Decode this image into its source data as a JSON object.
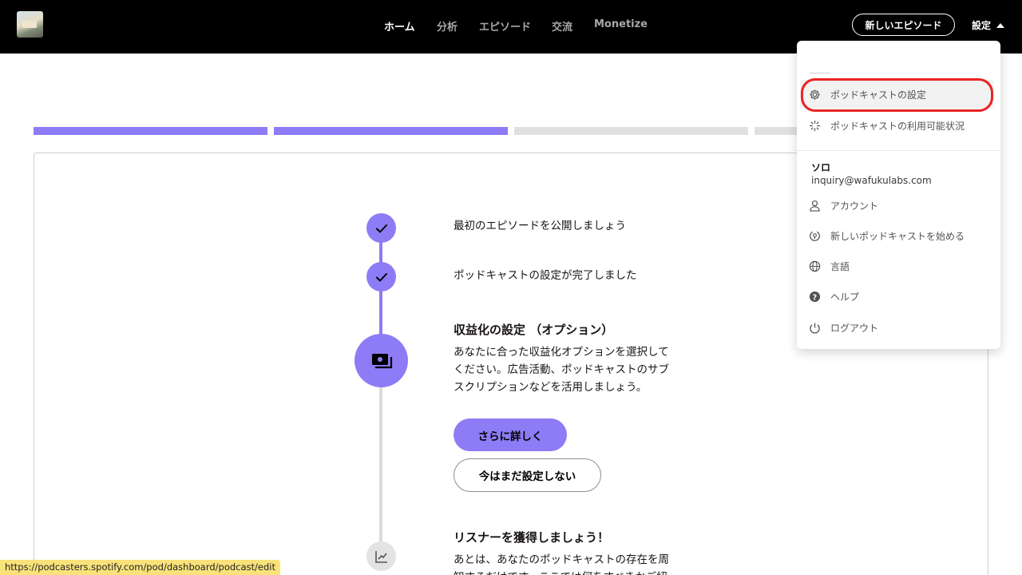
{
  "nav": {
    "items": [
      {
        "label": "ホーム",
        "active": true
      },
      {
        "label": "分析",
        "active": false
      },
      {
        "label": "エピソード",
        "active": false
      },
      {
        "label": "交流",
        "active": false
      },
      {
        "label": "Monetize",
        "active": false
      }
    ],
    "new_episode_label": "新しいエピソード",
    "settings_label": "設定"
  },
  "progress": {
    "completed_segments": 2,
    "total_segments": 4
  },
  "steps": {
    "step1": {
      "text": "最初のエピソードを公開しましょう",
      "status": "done"
    },
    "step2": {
      "text": "ポッドキャストの設定が完了しました",
      "status": "done"
    },
    "step3": {
      "title": "収益化の設定 （オプション）",
      "description": "あなたに合った収益化オプションを選択してください。広告活動、ポッドキャストのサブスクリプションなどを活用しましょう。",
      "primary_button": "さらに詳しく",
      "secondary_button": "今はまだ設定しない"
    },
    "step4": {
      "title": "リスナーを獲得しましょう！",
      "description": "あとは、あなたのポッドキャストの存在を周知するだけです。ここでは何をすべきかご紹介します。"
    }
  },
  "dropdown": {
    "items_top": [
      {
        "label": "ポッドキャストの設定",
        "icon": "gear-icon"
      },
      {
        "label": "ポッドキャストの利用可能状況",
        "icon": "sparkle-icon"
      }
    ],
    "user": {
      "name": "ソロ",
      "email": "inquiry@wafukulabs.com"
    },
    "items_bottom": [
      {
        "label": "アカウント",
        "icon": "user-icon"
      },
      {
        "label": "新しいポッドキャストを始める",
        "icon": "new-podcast-icon"
      },
      {
        "label": "言語",
        "icon": "globe-icon"
      },
      {
        "label": "ヘルプ",
        "icon": "help-icon"
      },
      {
        "label": "ログアウト",
        "icon": "power-icon"
      }
    ]
  },
  "statusbar": {
    "url": "https://podcasters.spotify.com/pod/dashboard/podcast/edit"
  },
  "colors": {
    "accent": "#8d7cf5",
    "highlight_ring": "#ea2323",
    "topbar": "#000000"
  }
}
